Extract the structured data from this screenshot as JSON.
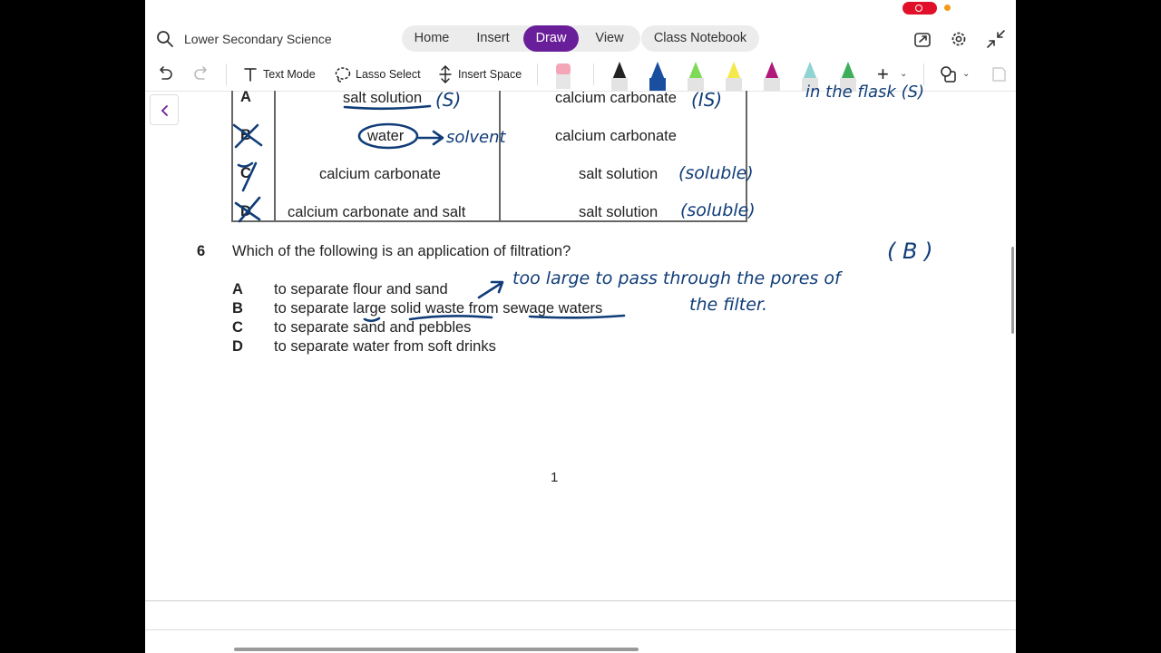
{
  "header": {
    "notebook_title": "Lower Secondary Science",
    "tabs": [
      {
        "label": "Home"
      },
      {
        "label": "Insert"
      },
      {
        "label": "Draw",
        "active": true
      },
      {
        "label": "View"
      }
    ],
    "class_notebook_label": "Class Notebook"
  },
  "toolbar": {
    "text_mode": "Text Mode",
    "lasso_select": "Lasso Select",
    "insert_space": "Insert Space",
    "pens": [
      {
        "name": "black-pen",
        "color": "#222222"
      },
      {
        "name": "blue-pen",
        "color": "#1a4fa0"
      },
      {
        "name": "green-highlighter",
        "color": "#7ed957"
      },
      {
        "name": "yellow-highlighter",
        "color": "#f5e84a"
      },
      {
        "name": "magenta-pen",
        "color": "#b0197a"
      },
      {
        "name": "teal-pen",
        "color": "#8fd3d3"
      },
      {
        "name": "green-pen",
        "color": "#3fae5a"
      }
    ],
    "eraser_color": "#f4a6b8"
  },
  "colors": {
    "accent": "#6a1f9a",
    "ink": "#103d78",
    "record": "#e0102a"
  },
  "table": {
    "rows": [
      {
        "letter": "A",
        "col1": "salt solution",
        "col2": "calcium carbonate"
      },
      {
        "letter": "B",
        "col1": "water",
        "col2": "calcium carbonate"
      },
      {
        "letter": "C",
        "col1": "calcium carbonate",
        "col2": "salt solution"
      },
      {
        "letter": "D",
        "col1": "calcium carbonate and salt",
        "col2": "salt solution"
      }
    ]
  },
  "question": {
    "number": "6",
    "text": "Which of the following is an application of filtration?",
    "options": [
      {
        "letter": "A",
        "text": "to separate flour and sand"
      },
      {
        "letter": "B",
        "text": "to separate large solid waste from sewage waters"
      },
      {
        "letter": "C",
        "text": "to separate sand and pebbles"
      },
      {
        "letter": "D",
        "text": "to separate water from soft drinks"
      }
    ]
  },
  "annotations": {
    "row_a_col1": "(S)",
    "row_a_col2": "(IS)",
    "solvent": "solvent",
    "soluble_1": "(soluble)",
    "soluble_2": "(soluble)",
    "answer": "( B )",
    "note_line1": "too large to pass through the pores of",
    "note_line2": "the filter.",
    "top_right_partial": "in the flask (S)"
  },
  "page_number": "1"
}
